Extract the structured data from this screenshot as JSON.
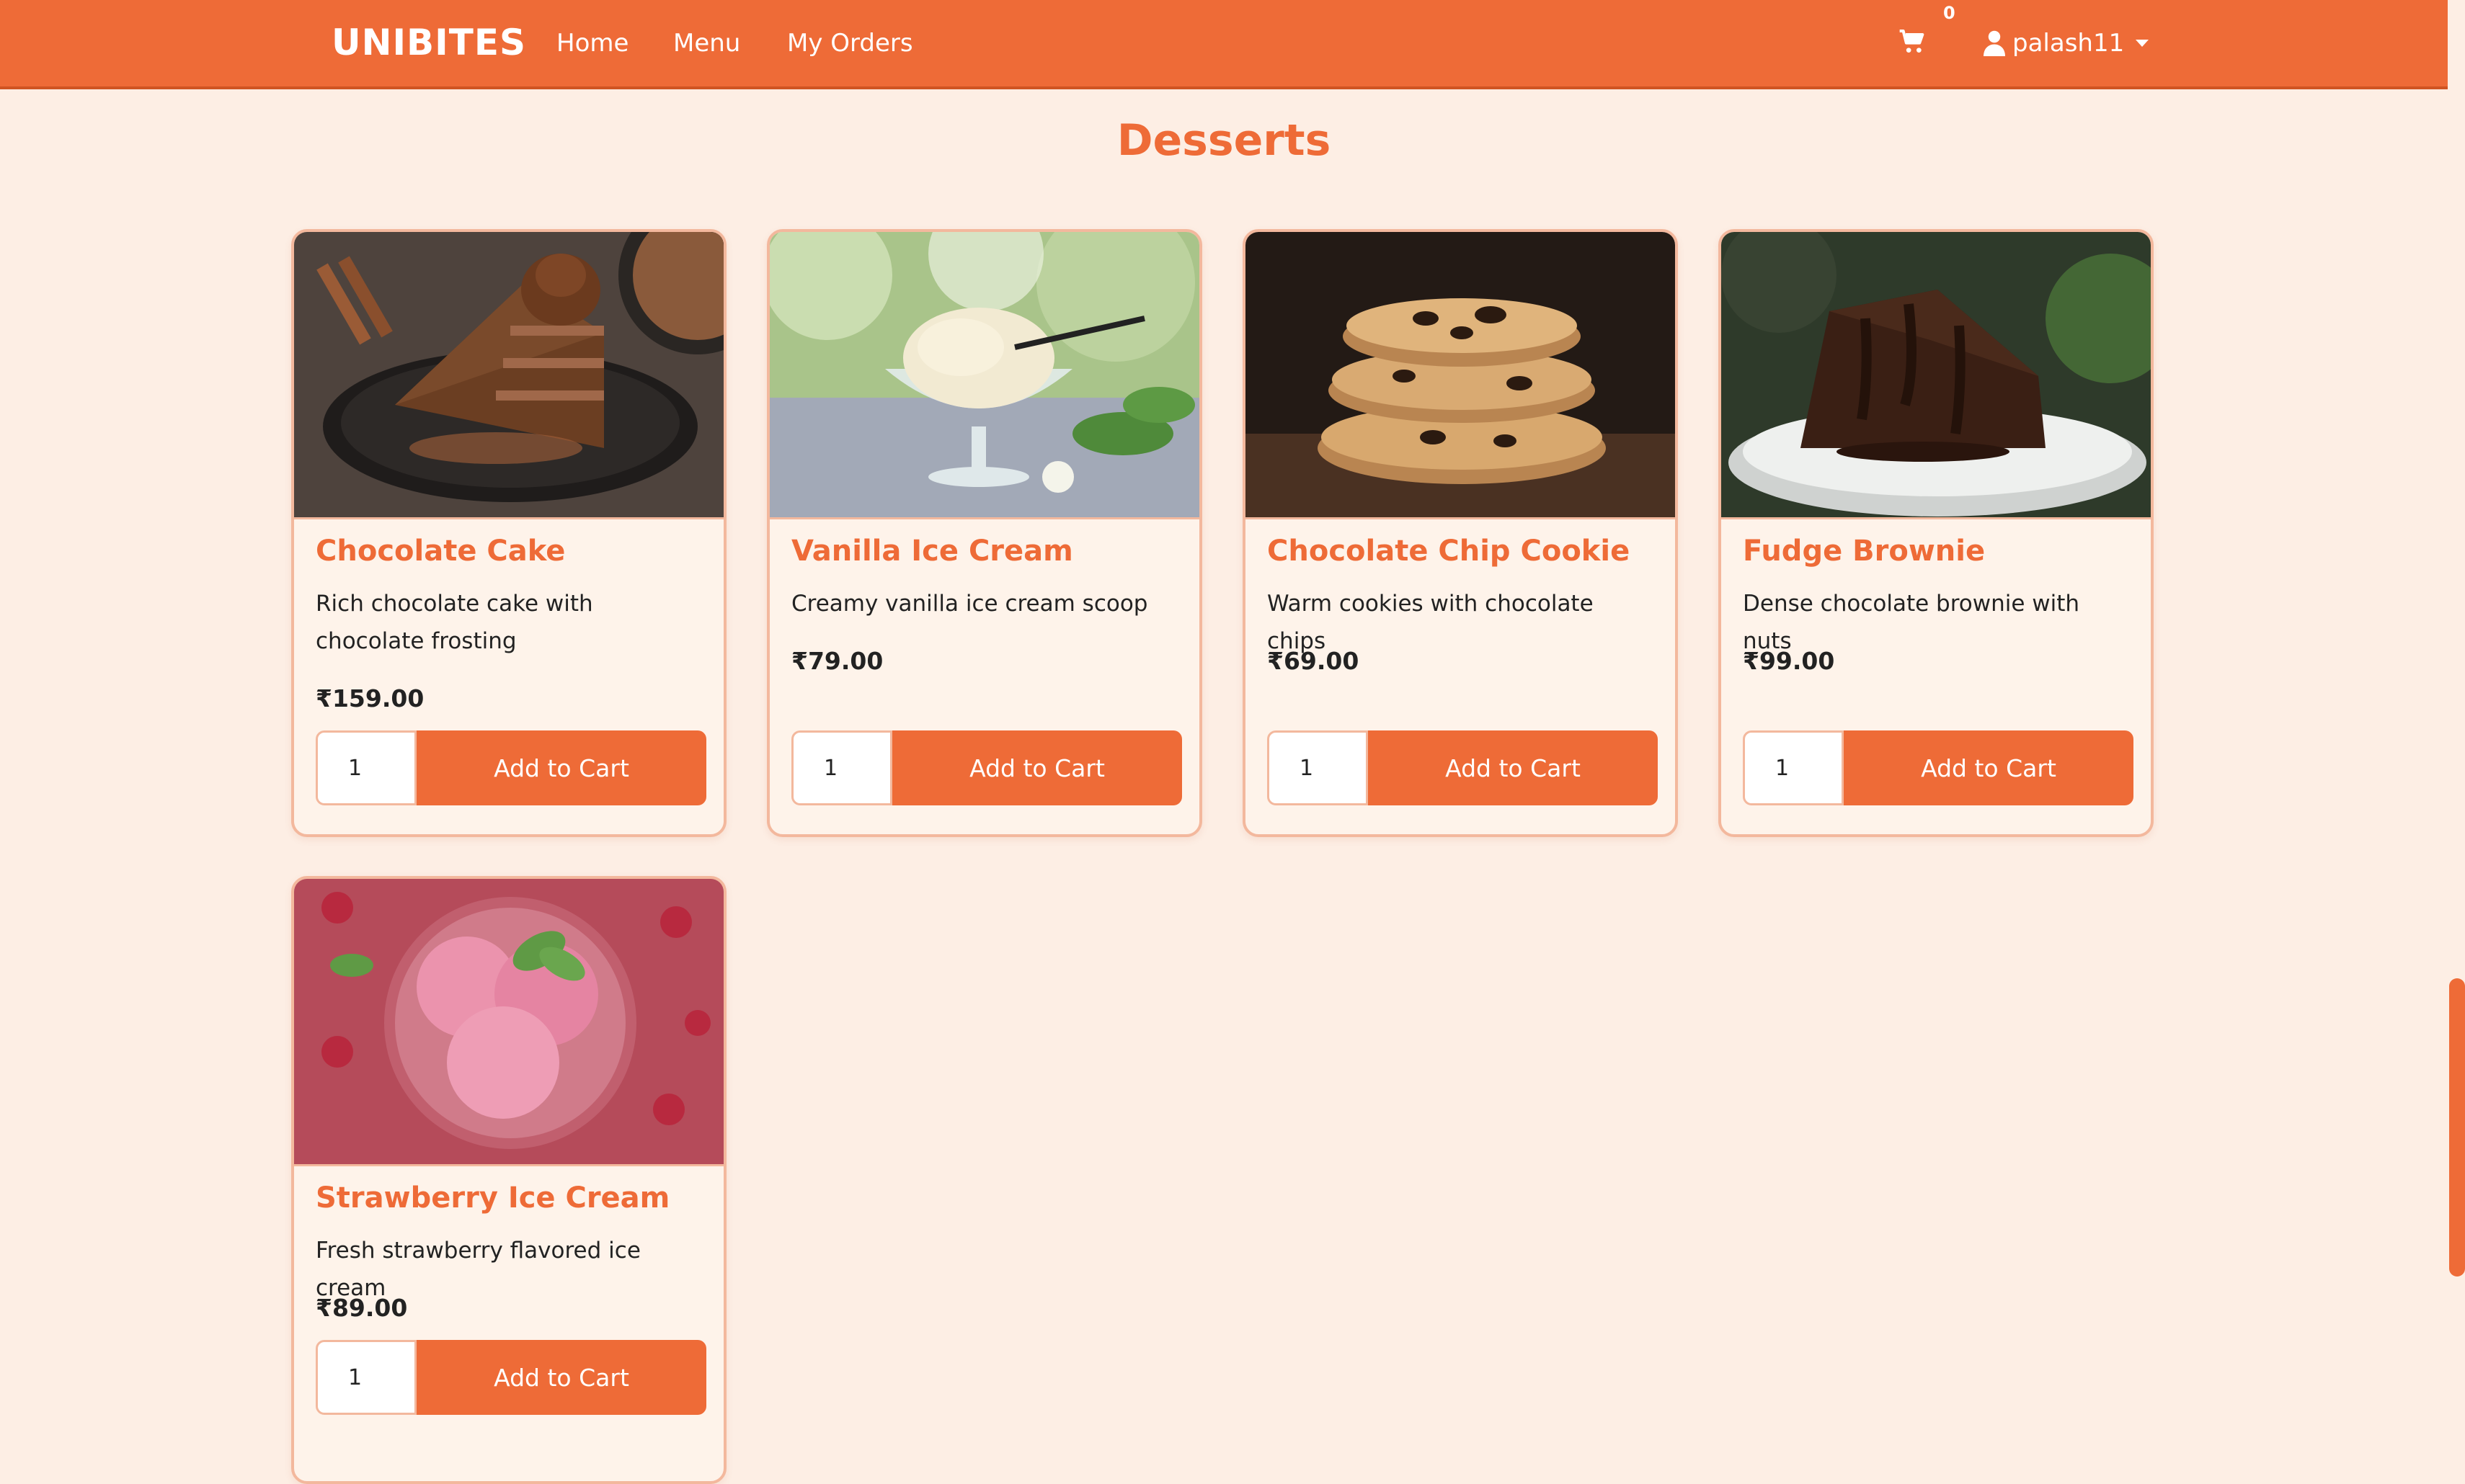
{
  "nav": {
    "brand": "UNIBITES",
    "links": [
      "Home",
      "Menu",
      "My Orders"
    ],
    "cart_count": "0",
    "username": "palash11"
  },
  "section": {
    "title": "Desserts"
  },
  "colors": {
    "accent": "#ee6b37",
    "background": "#fdeee4",
    "card_border": "#f3b89d"
  },
  "items": [
    {
      "name": "Chocolate Cake",
      "description": "Rich chocolate cake with chocolate frosting",
      "price": "₹159.00",
      "quantity": "1",
      "button": "Add to Cart"
    },
    {
      "name": "Vanilla Ice Cream",
      "description": "Creamy vanilla ice cream scoop",
      "price": "₹79.00",
      "quantity": "1",
      "button": "Add to Cart"
    },
    {
      "name": "Chocolate Chip Cookie",
      "description": "Warm cookies with chocolate chips",
      "price": "₹69.00",
      "quantity": "1",
      "button": "Add to Cart"
    },
    {
      "name": "Fudge Brownie",
      "description": "Dense chocolate brownie with nuts",
      "price": "₹99.00",
      "quantity": "1",
      "button": "Add to Cart"
    },
    {
      "name": "Strawberry Ice Cream",
      "description": "Fresh strawberry flavored ice cream",
      "price": "₹89.00",
      "quantity": "1",
      "button": "Add to Cart"
    }
  ]
}
